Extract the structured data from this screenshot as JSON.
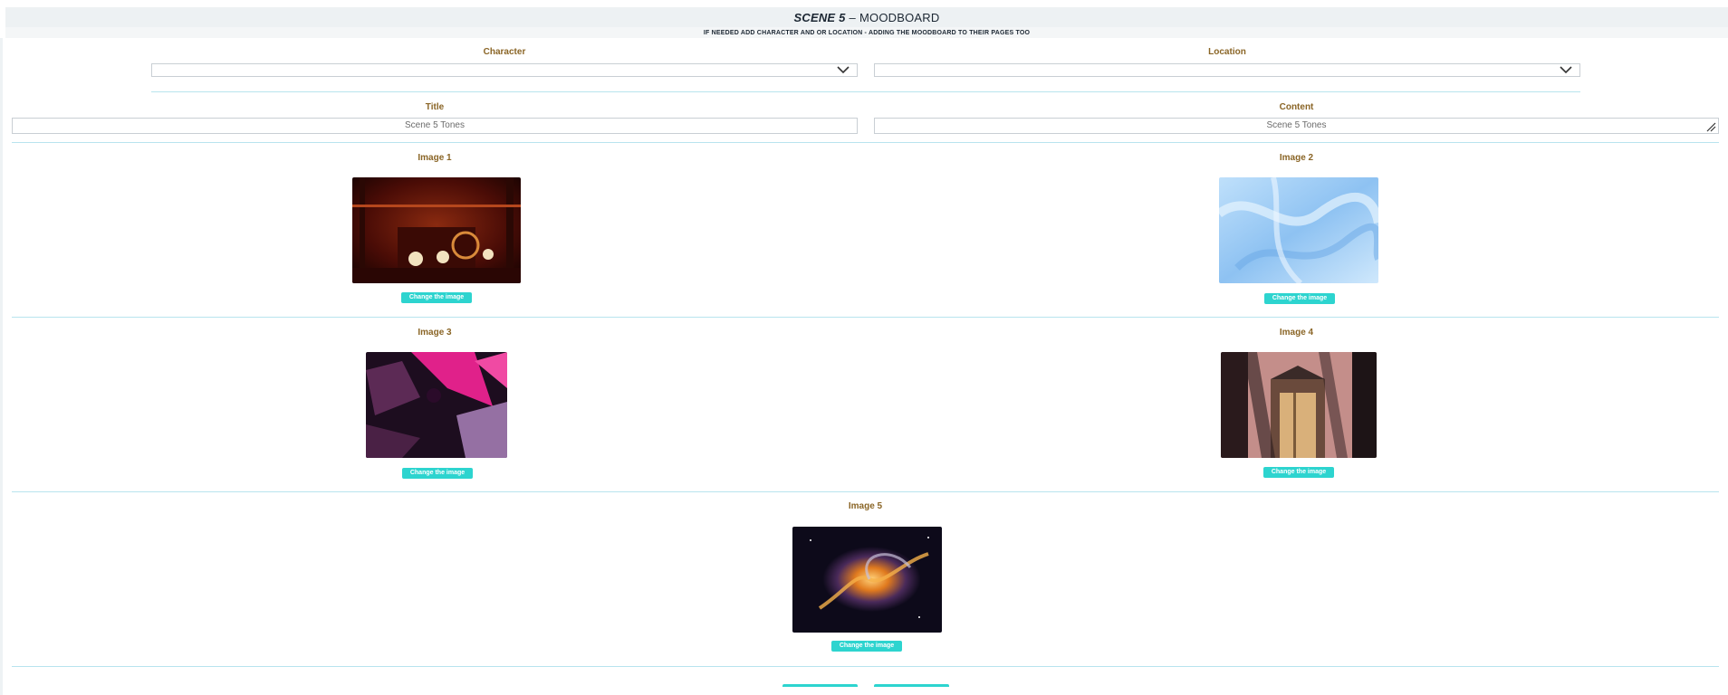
{
  "header": {
    "scene": "SCENE 5",
    "separator": "–",
    "title": "MOODBOARD",
    "subtitle": "IF NEEDED ADD CHARACTER AND OR LOCATION - ADDING THE MOODBOARD TO THEIR PAGES TOO"
  },
  "form": {
    "character_label": "Character",
    "character_value": "",
    "location_label": "Location",
    "location_value": "",
    "title_label": "Title",
    "title_value": "Scene 5 Tones",
    "content_label": "Content",
    "content_value": "Scene 5 Tones"
  },
  "images": [
    {
      "label": "Image 1",
      "button": "Change the image",
      "desc": "ornate red theatre interior"
    },
    {
      "label": "Image 2",
      "button": "Change the image",
      "desc": "light blue silk fabric"
    },
    {
      "label": "Image 3",
      "button": "Change the image",
      "desc": "magenta and black fabric texture"
    },
    {
      "label": "Image 4",
      "button": "Change the image",
      "desc": "building doorway with shadows"
    },
    {
      "label": "Image 5",
      "button": "Change the image",
      "desc": "orange cosmic swirl"
    }
  ],
  "colors": {
    "accent": "#2dd4cf",
    "label": "#8a6526",
    "divider": "#b8e4ee"
  }
}
